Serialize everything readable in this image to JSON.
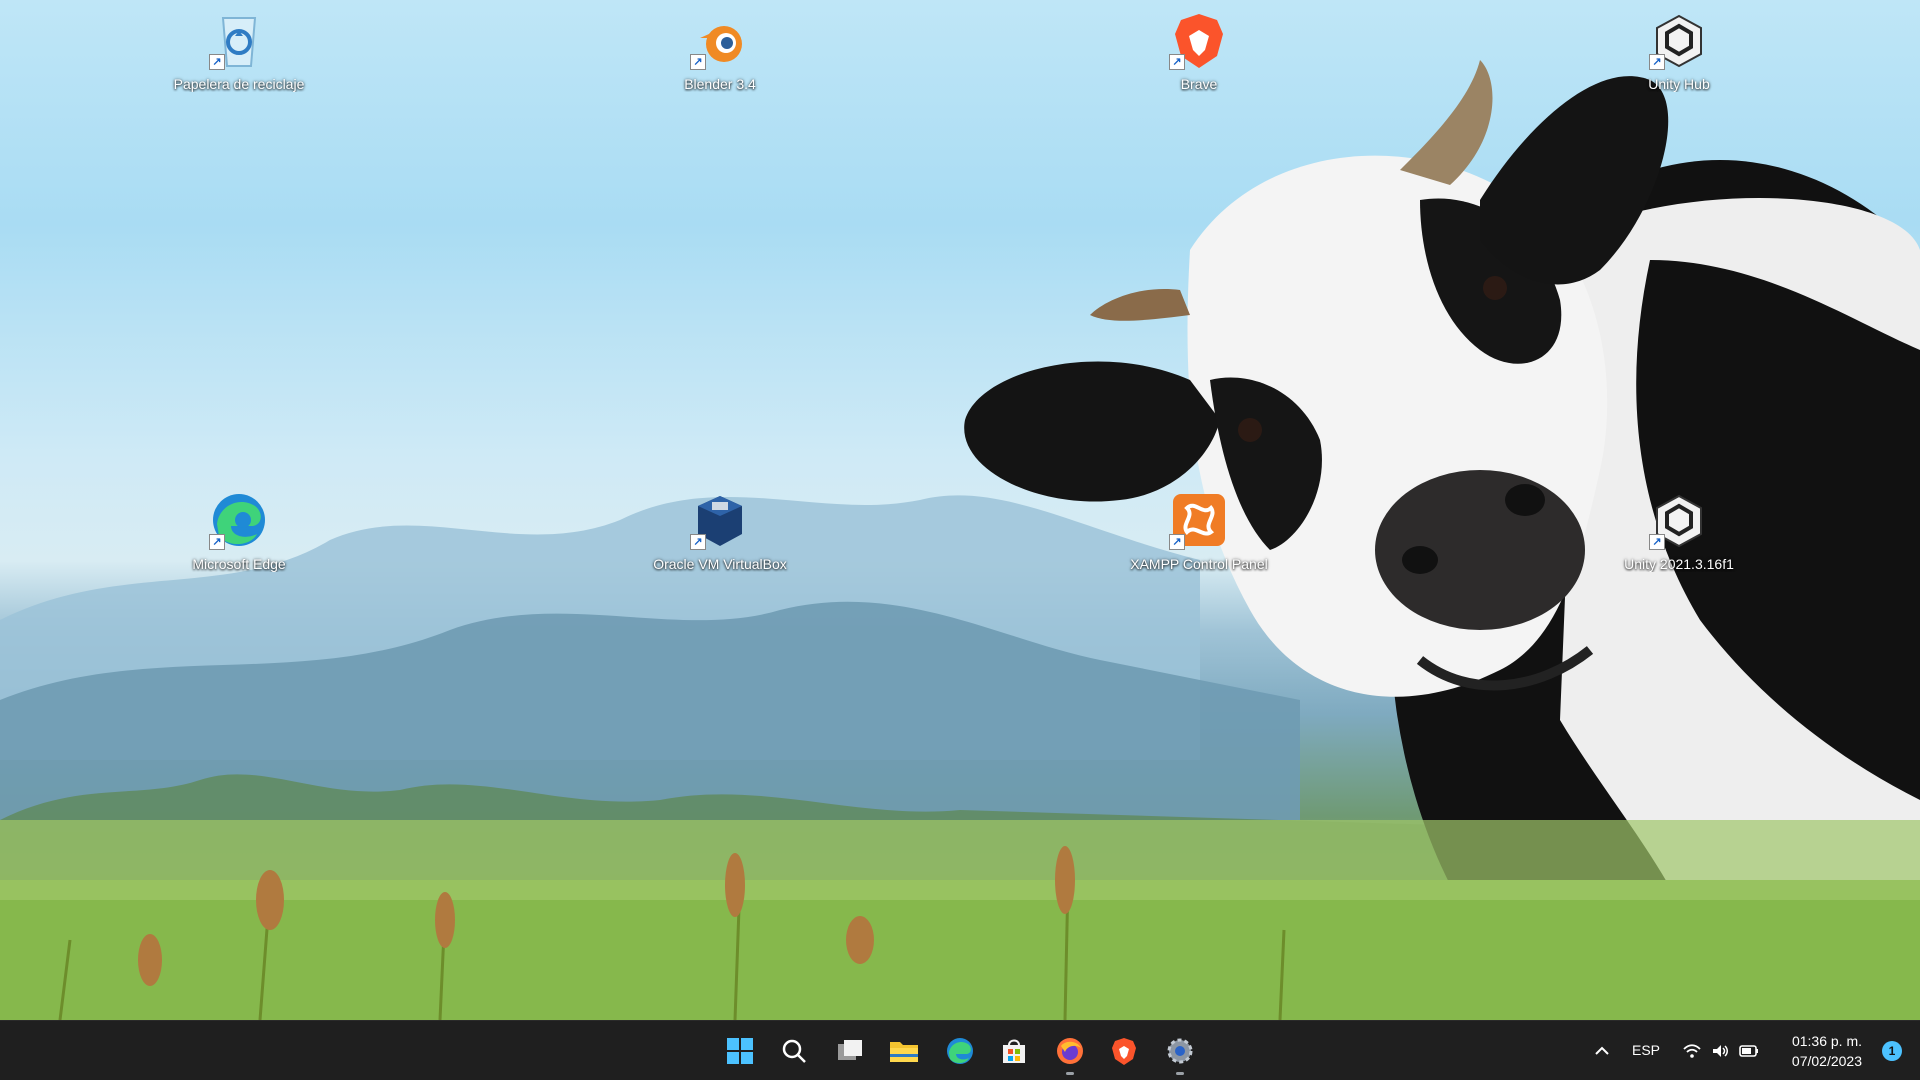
{
  "desktop": {
    "icons": [
      {
        "label": "Papelera de reciclaje",
        "icon": "recycle-bin-icon"
      },
      {
        "label": "Blender 3.4",
        "icon": "blender-icon"
      },
      {
        "label": "Brave",
        "icon": "brave-icon"
      },
      {
        "label": "Unity Hub",
        "icon": "unity-hub-icon"
      },
      {
        "label": "Microsoft Edge",
        "icon": "edge-icon"
      },
      {
        "label": "Oracle VM VirtualBox",
        "icon": "virtualbox-icon"
      },
      {
        "label": "XAMPP Control Panel",
        "icon": "xampp-icon"
      },
      {
        "label": "Unity 2021.3.16f1",
        "icon": "unity-icon"
      }
    ]
  },
  "taskbar": {
    "apps": [
      "start-icon",
      "search-icon",
      "task-view-icon",
      "file-explorer-icon",
      "edge-icon",
      "microsoft-store-icon",
      "firefox-icon",
      "brave-icon",
      "settings-icon"
    ],
    "tray": {
      "language": "ESP",
      "time": "01:36 p. m.",
      "date": "07/02/2023",
      "notification_count": "1"
    }
  },
  "colors": {
    "taskbar_bg": "#1f1f1f",
    "accent": "#4cc2ff"
  }
}
